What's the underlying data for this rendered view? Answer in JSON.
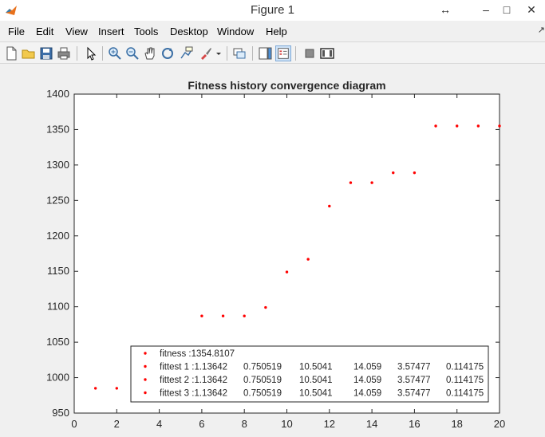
{
  "window": {
    "title": "Figure 1",
    "controls": {
      "resize_glyph": "↔",
      "minimize_glyph": "–",
      "maximize_glyph": "□",
      "close_glyph": "✕"
    }
  },
  "menu": [
    "File",
    "Edit",
    "View",
    "Insert",
    "Tools",
    "Desktop",
    "Window",
    "Help"
  ],
  "menu_corner_glyph": "↗",
  "toolbar": {
    "buttons": [
      "new-figure-icon",
      "open-file-icon",
      "save-icon",
      "print-icon",
      "pointer-icon",
      "zoom-in-icon",
      "zoom-out-icon",
      "pan-hand-icon",
      "rotate-3d-icon",
      "data-cursor-icon",
      "brush-icon",
      "brush-dropdown-icon",
      "link-plot-icon",
      "colorbar-icon",
      "legend-icon",
      "hide-plot-tools-icon",
      "show-plot-tools-icon"
    ]
  },
  "chart_data": {
    "type": "scatter",
    "title": "Fitness history convergence diagram",
    "xlabel": "",
    "ylabel": "",
    "xlim": [
      0,
      20
    ],
    "ylim": [
      950,
      1400
    ],
    "xticks": [
      "0",
      "2",
      "4",
      "6",
      "8",
      "10",
      "12",
      "14",
      "16",
      "18",
      "20"
    ],
    "yticks": [
      "950",
      "1000",
      "1050",
      "1100",
      "1150",
      "1200",
      "1250",
      "1300",
      "1350",
      "1400"
    ],
    "marker_color": "#ff0000",
    "grid": false,
    "legend_position": "bottom-right",
    "series": [
      {
        "x": [
          1,
          2,
          3,
          4,
          5,
          6,
          7,
          8,
          9,
          10,
          11,
          12,
          13,
          14,
          15,
          16,
          17,
          18,
          19,
          20
        ],
        "y": [
          985,
          985,
          985,
          985,
          985,
          1087,
          1087,
          1087,
          1099,
          1149,
          1167,
          1242,
          1275,
          1275,
          1289,
          1289,
          1355,
          1355,
          1355,
          1355
        ]
      }
    ],
    "legend": [
      {
        "label": "fitness :1354.8107",
        "values": []
      },
      {
        "label": "fittest 1 :1.13642",
        "values": [
          "0.750519",
          "10.5041",
          "14.059",
          "3.57477",
          "0.114175"
        ]
      },
      {
        "label": "fittest 2 :1.13642",
        "values": [
          "0.750519",
          "10.5041",
          "14.059",
          "3.57477",
          "0.114175"
        ]
      },
      {
        "label": "fittest 3 :1.13642",
        "values": [
          "0.750519",
          "10.5041",
          "14.059",
          "3.57477",
          "0.114175"
        ]
      }
    ]
  }
}
